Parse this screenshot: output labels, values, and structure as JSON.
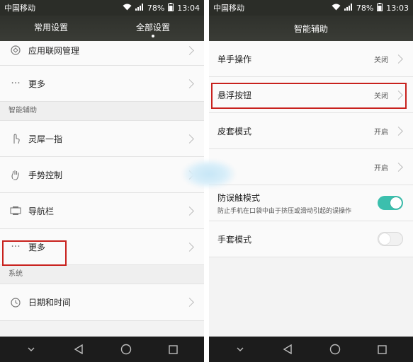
{
  "left": {
    "status": {
      "carrier": "中国移动",
      "battery": "78%",
      "time": "13:04"
    },
    "tabs": [
      {
        "label": "常用设置",
        "active": false
      },
      {
        "label": "全部设置",
        "active": true
      }
    ],
    "rows": [
      {
        "label": "应用联网管理",
        "icon": "network-apps-icon"
      },
      {
        "label": "更多",
        "icon": "more-dots-icon"
      }
    ],
    "section_assist": "智能辅助",
    "assist_rows": [
      {
        "label": "灵犀一指",
        "icon": "finger-touch-icon"
      },
      {
        "label": "手势控制",
        "icon": "hand-gesture-icon"
      },
      {
        "label": "导航栏",
        "icon": "navbar-icon"
      },
      {
        "label": "更多",
        "icon": "more-dots-icon"
      }
    ],
    "section_system": "系统",
    "system_rows": [
      {
        "label": "日期和时间",
        "icon": "clock-icon"
      }
    ]
  },
  "right": {
    "status": {
      "carrier": "中国移动",
      "battery": "78%",
      "time": "13:03"
    },
    "title": "智能辅助",
    "rows": [
      {
        "label": "单手操作",
        "value": "关闭"
      },
      {
        "label": "悬浮按钮",
        "value": "关闭"
      },
      {
        "label": "皮套模式",
        "value": "开启"
      },
      {
        "label": "",
        "value": "开启"
      }
    ],
    "toggle_rows": [
      {
        "label": "防误触模式",
        "sub": "防止手机在口袋中由于挤压或滑动引起的误操作",
        "on": true
      },
      {
        "label": "手套模式",
        "sub": "",
        "on": false
      }
    ]
  },
  "colors": {
    "accent": "#3bbfad",
    "highlight": "#c8211d",
    "titlebar": "#2f312c"
  }
}
